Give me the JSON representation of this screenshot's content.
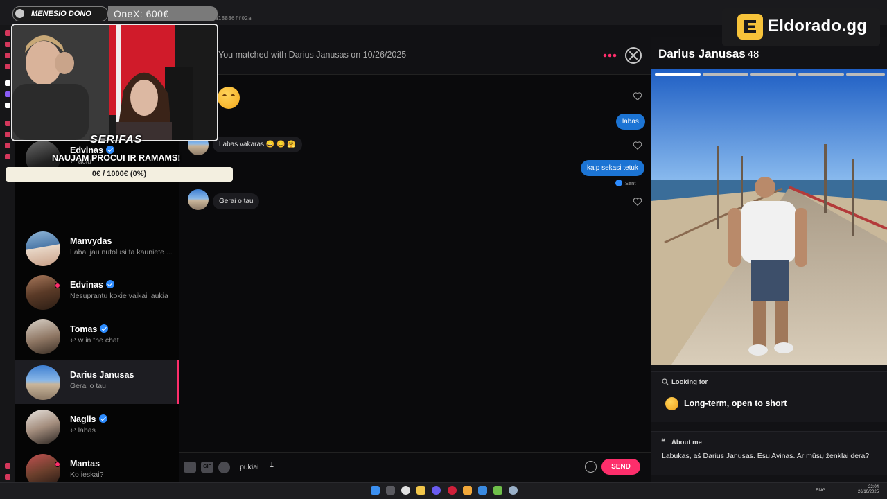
{
  "browser": {
    "url_fragment": "ca18886ff02a"
  },
  "overlay": {
    "donor": "MENESIO DONO",
    "onex": "OneX: 600€",
    "cam_name": "SERIFAS",
    "cam_motto": "NAUJAM PROCUI IR RAMAMS!",
    "goal": "0€ / 1000€ (0%)"
  },
  "brand": {
    "name": "Eldorado.gg"
  },
  "sidebar": {
    "items": [
      {
        "name": "Edvinas",
        "verified": true,
        "preview": "↩ aciu",
        "online": false
      },
      {
        "name": "Manvydas",
        "verified": false,
        "preview": "Labai jau nutolusi ta kauniete ...",
        "online": false
      },
      {
        "name": "Edvinas",
        "verified": true,
        "preview": "Nesuprantu kokie vaikai laukia",
        "online": true
      },
      {
        "name": "Tomas",
        "verified": true,
        "preview": "↩ w in the chat",
        "online": false
      },
      {
        "name": "Darius Janusas",
        "verified": false,
        "preview": "Gerai o tau",
        "online": false,
        "active": true
      },
      {
        "name": "Naglis",
        "verified": true,
        "preview": "↩ labas",
        "online": false
      },
      {
        "name": "Mantas",
        "verified": false,
        "preview": "Ko ieskai?",
        "online": true
      }
    ]
  },
  "conversation": {
    "match_text": "You matched with Darius Janusas on 10/26/2025",
    "messages": [
      {
        "dir": "out",
        "text": "labas"
      },
      {
        "dir": "in",
        "text": "Labas vakaras 😄 😊 🤗"
      },
      {
        "dir": "out",
        "text": "kaip sekasi tetuk"
      },
      {
        "dir": "in",
        "text": "Gerai o tau"
      }
    ],
    "sent_status": "Sent"
  },
  "composer": {
    "gif_label": "GIF",
    "value": "pukiai",
    "send_label": "SEND"
  },
  "profile": {
    "name": "Darius Janusas",
    "age": "48",
    "looking_for_label": "Looking for",
    "looking_for_value": "Long-term, open to short",
    "about_label": "About me",
    "about_text": "Labukas, aš Darius Janusas. Esu Avinas. Ar mūsų ženklai dera?"
  },
  "taskbar": {
    "lang": "ENG",
    "time": "22:04",
    "date": "26/10/2025"
  },
  "colors": {
    "accent": "#fd2e6b",
    "outgoing_bubble": "#1c74d4",
    "verified": "#2d8cff"
  }
}
